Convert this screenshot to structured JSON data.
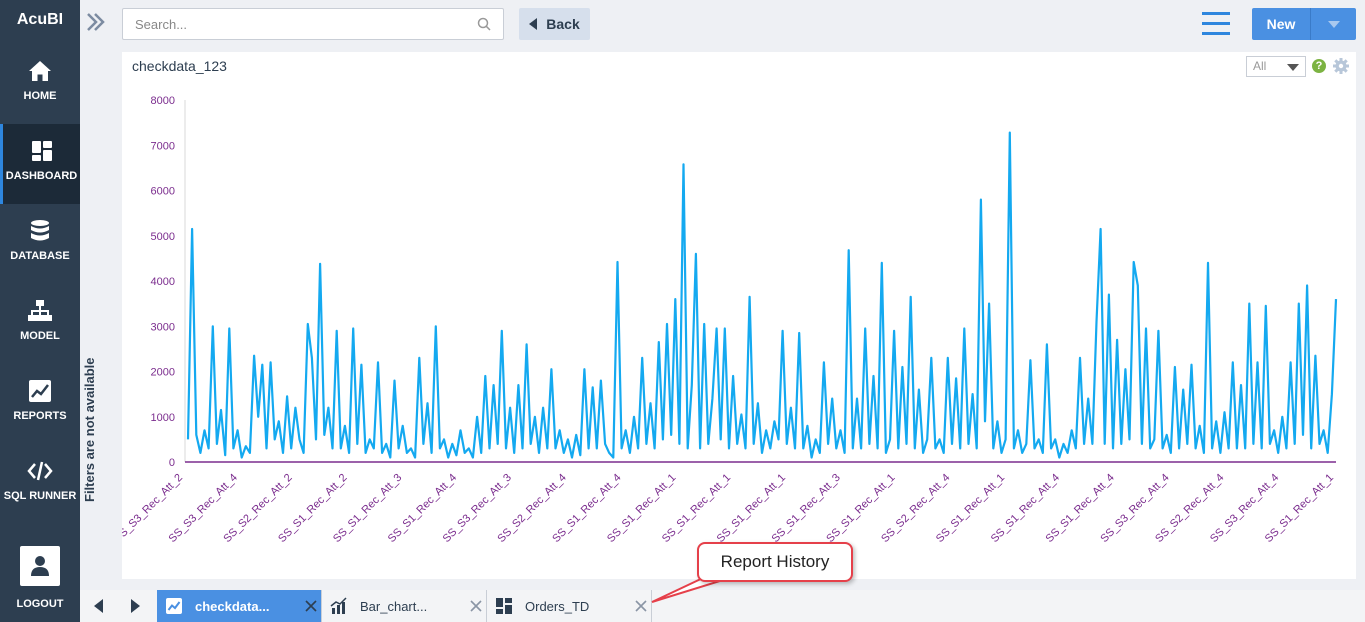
{
  "app": {
    "brand": "AcuBI"
  },
  "sidebar": {
    "items": [
      {
        "label": "HOME",
        "icon": "home-icon"
      },
      {
        "label": "DASHBOARD",
        "icon": "dashboard-icon",
        "active": true
      },
      {
        "label": "DATABASE",
        "icon": "database-icon"
      },
      {
        "label": "MODEL",
        "icon": "model-icon"
      },
      {
        "label": "REPORTS",
        "icon": "reports-icon"
      },
      {
        "label": "SQL RUNNER",
        "icon": "sql-runner-icon"
      }
    ],
    "logout_label": "LOGOUT"
  },
  "filters": {
    "message": "Filters are not available"
  },
  "toolbar": {
    "search_placeholder": "Search...",
    "back_label": "Back",
    "new_label": "New"
  },
  "report": {
    "title": "checkdata_123",
    "range_value": "All",
    "help_glyph": "?"
  },
  "tabs": [
    {
      "label": "checkdata...",
      "icon": "line-chart-icon",
      "active": true
    },
    {
      "label": "Bar_chart...",
      "icon": "bar-chart-icon",
      "active": false
    },
    {
      "label": "Orders_TD",
      "icon": "dashboard-icon",
      "active": false
    }
  ],
  "callout": {
    "text": "Report History"
  },
  "colors": {
    "sidebar": "#2d3e50",
    "accent": "#4a90e2",
    "line": "#14a9f0",
    "axis_labels": "#7b2d8e",
    "callout_border": "#e5404a"
  },
  "chart_data": {
    "type": "line",
    "title": "",
    "xlabel": "",
    "ylabel": "",
    "ylim": [
      0,
      8000
    ],
    "yticks": [
      0,
      1000,
      2000,
      3000,
      4000,
      5000,
      6000,
      7000,
      8000
    ],
    "x_tick_labels": [
      "SS_S3_Rec_Att_2",
      "SS_S3_Rec_Att_4",
      "SS_S2_Rec_Att_2",
      "SS_S1_Rec_Att_2",
      "SS_S1_Rec_Att_3",
      "SS_S1_Rec_Att_4",
      "SS_S3_Rec_Att_3",
      "SS_S2_Rec_Att_4",
      "SS_S1_Rec_Att_4",
      "SS_S1_Rec_Att_1",
      "SS_S1_Rec_Att_1",
      "SS_S1_Rec_Att_1",
      "SS_S1_Rec_Att_3",
      "SS_S1_Rec_Att_1",
      "SS_S2_Rec_Att_4",
      "SS_S1_Rec_Att_1",
      "SS_S1_Rec_Att_4",
      "SS_S1_Rec_Att_4",
      "SS_S3_Rec_Att_4",
      "SS_S2_Rec_Att_4",
      "SS_S3_Rec_Att_4",
      "SS_S1_Rec_Att_1"
    ],
    "series": [
      {
        "values": [
          500,
          5150,
          600,
          200,
          700,
          300,
          3000,
          400,
          1150,
          150,
          2950,
          300,
          700,
          100,
          350,
          200,
          2350,
          1000,
          2150,
          300,
          2200,
          500,
          900,
          200,
          1450,
          300,
          1200,
          500,
          200,
          3050,
          2300,
          500,
          4380,
          600,
          1200,
          300,
          2900,
          300,
          800,
          200,
          2950,
          400,
          2150,
          200,
          500,
          300,
          2200,
          200,
          400,
          100,
          1800,
          300,
          800,
          200,
          300,
          100,
          2300,
          400,
          1300,
          200,
          3000,
          300,
          500,
          100,
          400,
          150,
          700,
          200,
          300,
          100,
          1000,
          200,
          1900,
          300,
          1700,
          400,
          2900,
          300,
          1200,
          200,
          1700,
          300,
          2600,
          400,
          1000,
          200,
          1200,
          300,
          2050,
          300,
          700,
          200,
          500,
          100,
          600,
          150,
          2050,
          300,
          1650,
          300,
          1800,
          400,
          200,
          100,
          4420,
          300,
          700,
          200,
          1000,
          300,
          2300,
          400,
          1300,
          300,
          2650,
          500,
          3050,
          600,
          3600,
          400,
          6580,
          300,
          1700,
          4600,
          300,
          3050,
          400,
          1400,
          2950,
          500,
          2950,
          300,
          1900,
          400,
          1050,
          300,
          3650,
          400,
          1300,
          200,
          700,
          300,
          900,
          500,
          2900,
          400,
          1200,
          300,
          2850,
          300,
          800,
          100,
          500,
          200,
          2200,
          400,
          1400,
          300,
          700,
          200,
          4680,
          300,
          1400,
          300,
          2950,
          400,
          1900,
          300,
          4400,
          200,
          500,
          2900,
          300,
          2100,
          400,
          3650,
          300,
          1600,
          200,
          500,
          2300,
          300,
          500,
          200,
          2300,
          400,
          1850,
          300,
          2950,
          400,
          1500,
          300,
          5800,
          900,
          3500,
          300,
          900,
          200,
          500,
          7280,
          300,
          700,
          200,
          400,
          2250,
          300,
          500,
          200,
          2600,
          300,
          500,
          100,
          400,
          200,
          700,
          300,
          2300,
          400,
          1400,
          400,
          3100,
          5150,
          400,
          3700,
          300,
          2700,
          400,
          2050,
          500,
          4420,
          3900,
          400,
          2950,
          300,
          500,
          2900,
          300,
          600,
          200,
          2100,
          300,
          1600,
          400,
          2150,
          300,
          800,
          200,
          4400,
          300,
          900,
          200,
          1100,
          300,
          2200,
          300,
          1700,
          300,
          3500,
          400,
          2200,
          300,
          3450,
          400,
          700,
          200,
          1000,
          300,
          2200,
          400,
          3500,
          600,
          3900,
          300,
          2350,
          400,
          700,
          200,
          1500,
          3600
        ]
      }
    ]
  }
}
